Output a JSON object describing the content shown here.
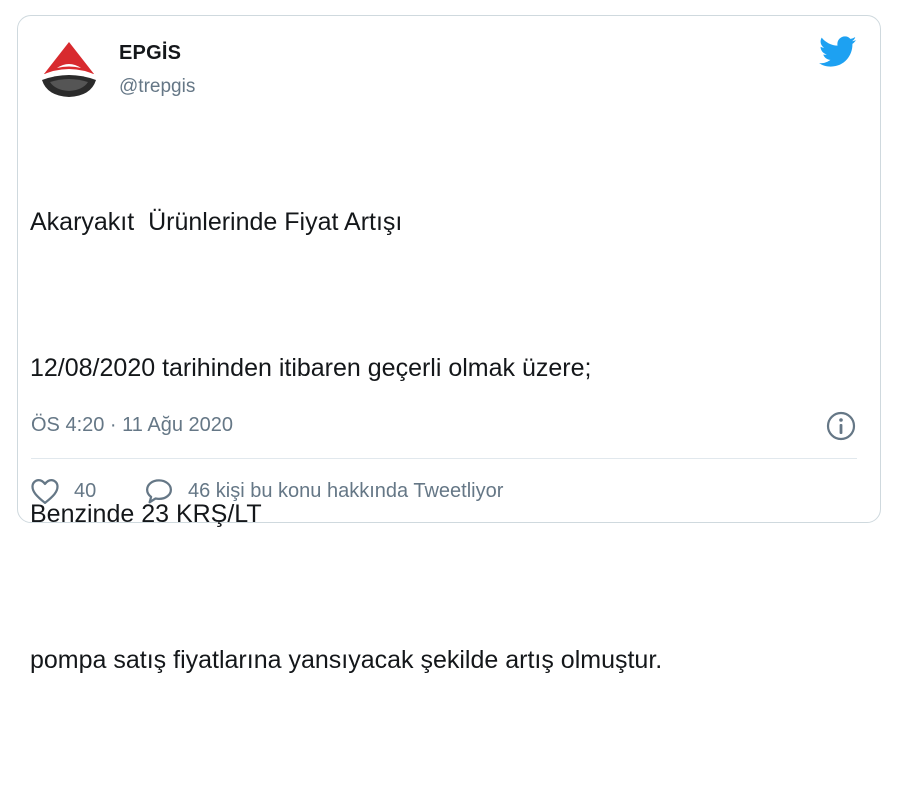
{
  "tweet": {
    "display_name": "EPGİS",
    "handle": "@trepgis",
    "body": [
      "Akaryakıt  Ürünlerinde Fiyat Artışı",
      "12/08/2020 tarihinden itibaren geçerli olmak üzere;",
      "Benzinde 23 KRŞ/LT",
      "pompa satış fiyatlarına yansıyacak şekilde artış olmuştur."
    ],
    "timestamp": "ÖS 4:20 · 11 Ağu 2020",
    "like_count": "40",
    "reply_text": "46 kişi bu konu hakkında Tweetliyor"
  },
  "icons": {
    "avatar": "epgis-logo-icon",
    "brand": "twitter-bird-icon",
    "info": "info-icon",
    "like": "heart-icon",
    "reply": "speech-bubble-icon"
  },
  "colors": {
    "twitter_blue": "#1da1f2",
    "logo_red": "#d82a2e",
    "logo_dark": "#2b2b2b",
    "text_primary": "#14171a",
    "text_secondary": "#657786",
    "border": "#cfd9de"
  }
}
